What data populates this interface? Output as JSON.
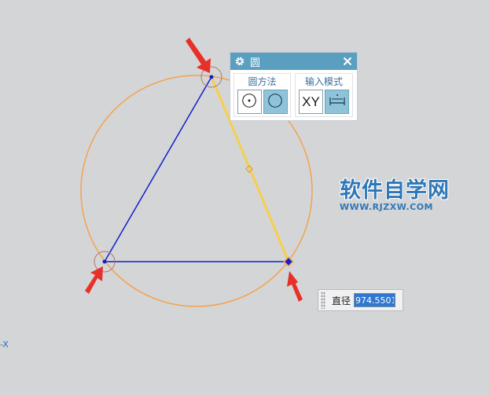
{
  "dialog": {
    "title": "圆",
    "group_method_label": "圆方法",
    "group_input_label": "输入模式",
    "xy_label": "XY"
  },
  "dimension": {
    "label": "直径",
    "value": "974.5501"
  },
  "watermark": {
    "main": "软件自学网",
    "sub": "WWW.RJZXW.COM"
  },
  "axis": {
    "label": "-X"
  },
  "colors": {
    "circle": "#f4a24d",
    "triangle": "#1020c8",
    "rubber_band": "#f6d04a",
    "arrow": "#e8302a",
    "header": "#5a9fc0"
  },
  "icons": [
    "gear-icon",
    "close-icon",
    "center-point-icon",
    "three-point-circle-icon",
    "parameter-mode-icon",
    "red-arrow-icon"
  ]
}
